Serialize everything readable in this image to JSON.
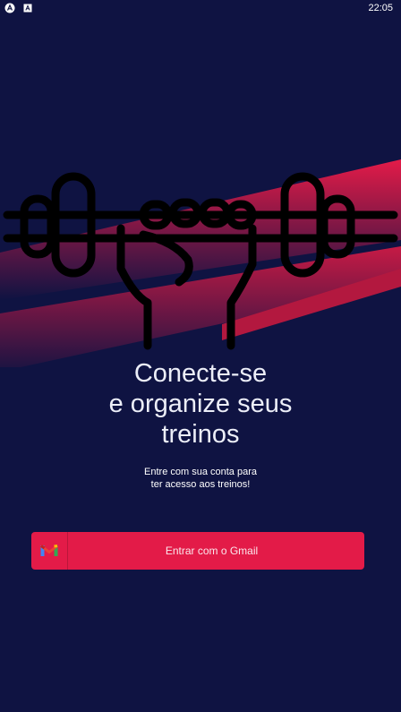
{
  "status_bar": {
    "time": "22:05",
    "icons": [
      "android-notification-icon",
      "app-notification-icon"
    ]
  },
  "hero": {
    "icon": "dumbbell-fist-icon",
    "stripe_color": "#e31b48"
  },
  "title": {
    "line1": "Conecte-se",
    "line2": "e organize seus",
    "line3": "treinos"
  },
  "subtitle": {
    "line1": "Entre com sua conta para",
    "line2": "ter acesso aos treinos!"
  },
  "login_button": {
    "label": "Entrar com o Gmail",
    "icon": "gmail-icon"
  },
  "colors": {
    "background": "#0f1342",
    "accent": "#e31b48"
  }
}
